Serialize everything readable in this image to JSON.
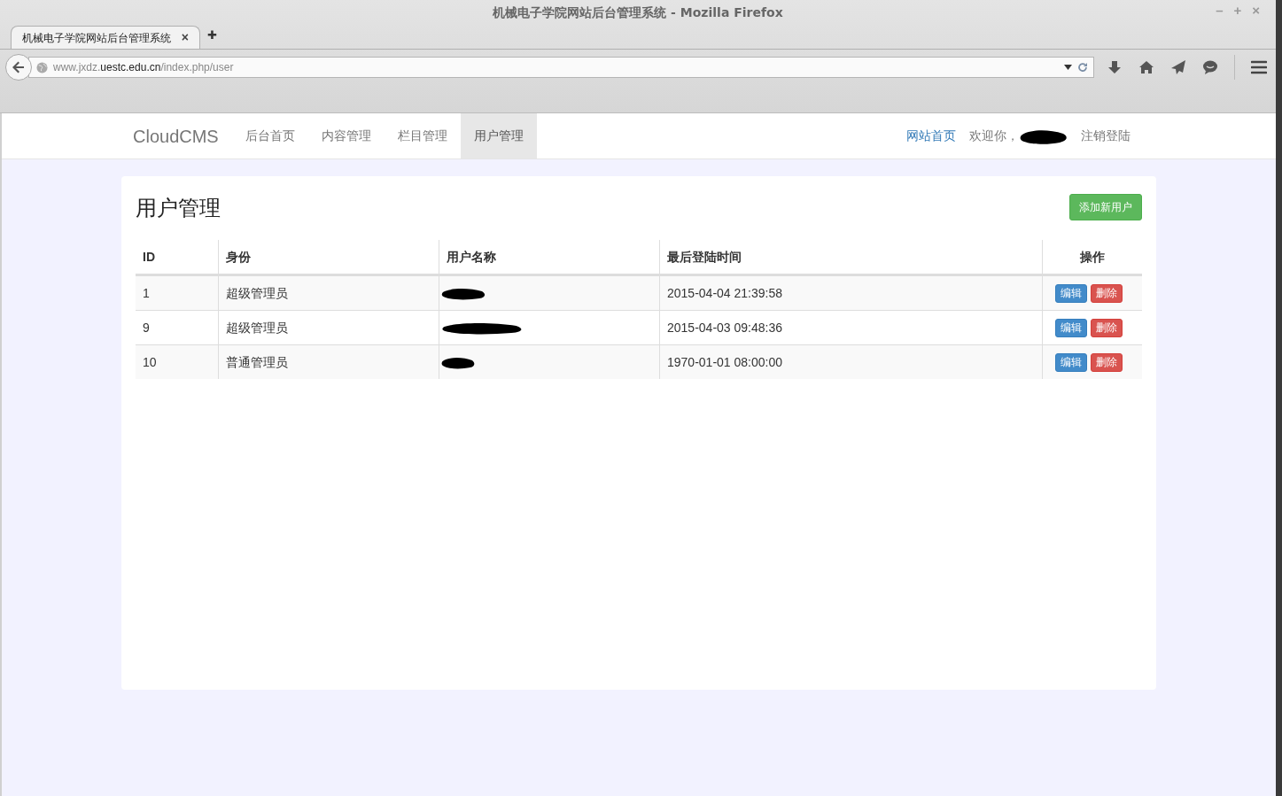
{
  "window": {
    "title": "机械电子学院网站后台管理系统 - Mozilla Firefox",
    "controls": [
      "–",
      "+",
      "×"
    ]
  },
  "tabs": [
    {
      "label": "机械电子学院网站后台管理系统",
      "selected": true,
      "close": "×"
    }
  ],
  "new_tab": "✚",
  "address": {
    "prefix": "www.jxdz.",
    "domain": "uestc.edu.cn",
    "path": "/index.php/user"
  },
  "navbar": {
    "brand": "CloudCMS",
    "items": [
      {
        "label": "后台首页",
        "selected": false
      },
      {
        "label": "内容管理",
        "selected": false
      },
      {
        "label": "栏目管理",
        "selected": false
      },
      {
        "label": "用户管理",
        "selected": true
      }
    ],
    "site_link": "网站首页",
    "welcome": "欢迎你，",
    "logout": "注销登陆"
  },
  "panel": {
    "title": "用户管理",
    "add_button": "添加新用户",
    "columns": [
      "ID",
      "身份",
      "用户名称",
      "最后登陆时间",
      "操作"
    ],
    "rows": [
      {
        "id": "1",
        "role": "超级管理员",
        "last_login": "2015-04-04 21:39:58",
        "edit": "编辑",
        "delete": "删除"
      },
      {
        "id": "9",
        "role": "超级管理员",
        "last_login": "2015-04-03 09:48:36",
        "edit": "编辑",
        "delete": "删除"
      },
      {
        "id": "10",
        "role": "普通管理员",
        "last_login": "1970-01-01 08:00:00",
        "edit": "编辑",
        "delete": "删除"
      }
    ]
  }
}
